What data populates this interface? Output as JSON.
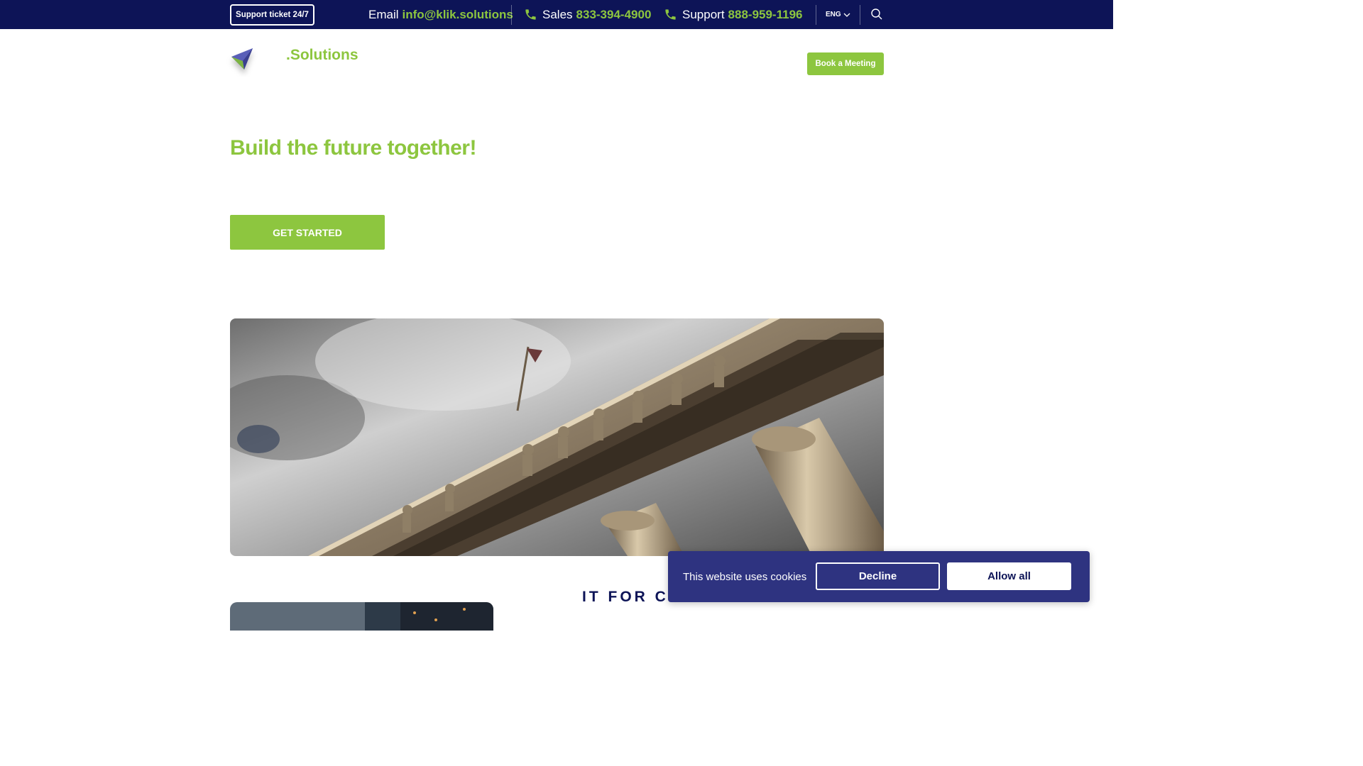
{
  "topbar": {
    "support_ticket_label": "Support ticket 24/7",
    "email_label": "Email",
    "email_value": "info@klik.solutions",
    "sales_label": "Sales",
    "sales_value": "833-394-4900",
    "support_label": "Support",
    "support_value": "888-959-1196",
    "language": "ENG"
  },
  "header": {
    "brand": ".Solutions",
    "book_meeting_label": "Book a Meeting"
  },
  "hero": {
    "title": "Build the future together!",
    "cta_label": "GET STARTED"
  },
  "section": {
    "heading": "IT FOR CONSTRUCTION"
  },
  "cookie_banner": {
    "text": "This website uses cookies",
    "decline_label": "Decline",
    "allow_label": "Allow all"
  },
  "colors": {
    "navy": "#0d1457",
    "green": "#8dc63f",
    "cookie_bg": "#2e3380"
  }
}
